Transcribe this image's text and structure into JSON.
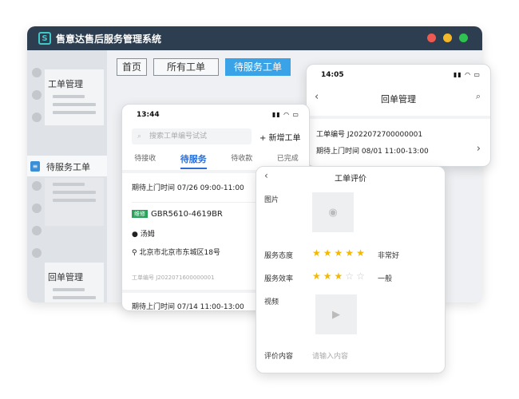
{
  "app": {
    "title": "售意达售后服务管理系统",
    "logo_letter": "S",
    "window_dots": [
      "#ee5a52",
      "#f5b72a",
      "#2fc250"
    ]
  },
  "sidebar": {
    "items": [
      {
        "label": "工单管理"
      },
      {
        "label": "待服务工单"
      },
      {
        "label": "回单管理"
      }
    ]
  },
  "tabs": [
    {
      "label": "首页"
    },
    {
      "label": "所有工单"
    },
    {
      "label": "待服务工单"
    }
  ],
  "phoneA": {
    "time": "13:44",
    "search_placeholder": "搜索工单编号试试",
    "add_label": "+ 新增工单",
    "subtabs": [
      "待接收",
      "待服务",
      "待收款",
      "已完成"
    ],
    "active_subtab": "待服务",
    "order1": {
      "time_label": "期待上门时间  07/26 09:00-11:00",
      "tag": "维修",
      "code": "GBR5610-4619BR",
      "person": "汤姆",
      "address": "北京市北京市东城区18号",
      "number": "工单编号 J2022071600000001"
    },
    "order2": {
      "time_label": "期待上门时间  07/14 11:00-13:00"
    }
  },
  "phoneB": {
    "time": "14:05",
    "title": "回单管理",
    "order_number": "工单编号 J2022072700000001",
    "time_label": "期待上门时间 08/01 11:00-13:00"
  },
  "phoneC": {
    "title": "工单评价",
    "picture_label": "图片",
    "attitude_label": "服务态度",
    "attitude_stars": 5,
    "attitude_text": "非常好",
    "efficiency_label": "服务效率",
    "efficiency_stars": 3,
    "efficiency_text": "一般",
    "video_label": "视频",
    "content_label": "评价内容",
    "content_placeholder": "请输入内容"
  },
  "colors": {
    "titlebar": "#2c3e50",
    "accent": "#3aa3e8",
    "active_blue": "#2b6ed6",
    "star": "#f5b800"
  }
}
